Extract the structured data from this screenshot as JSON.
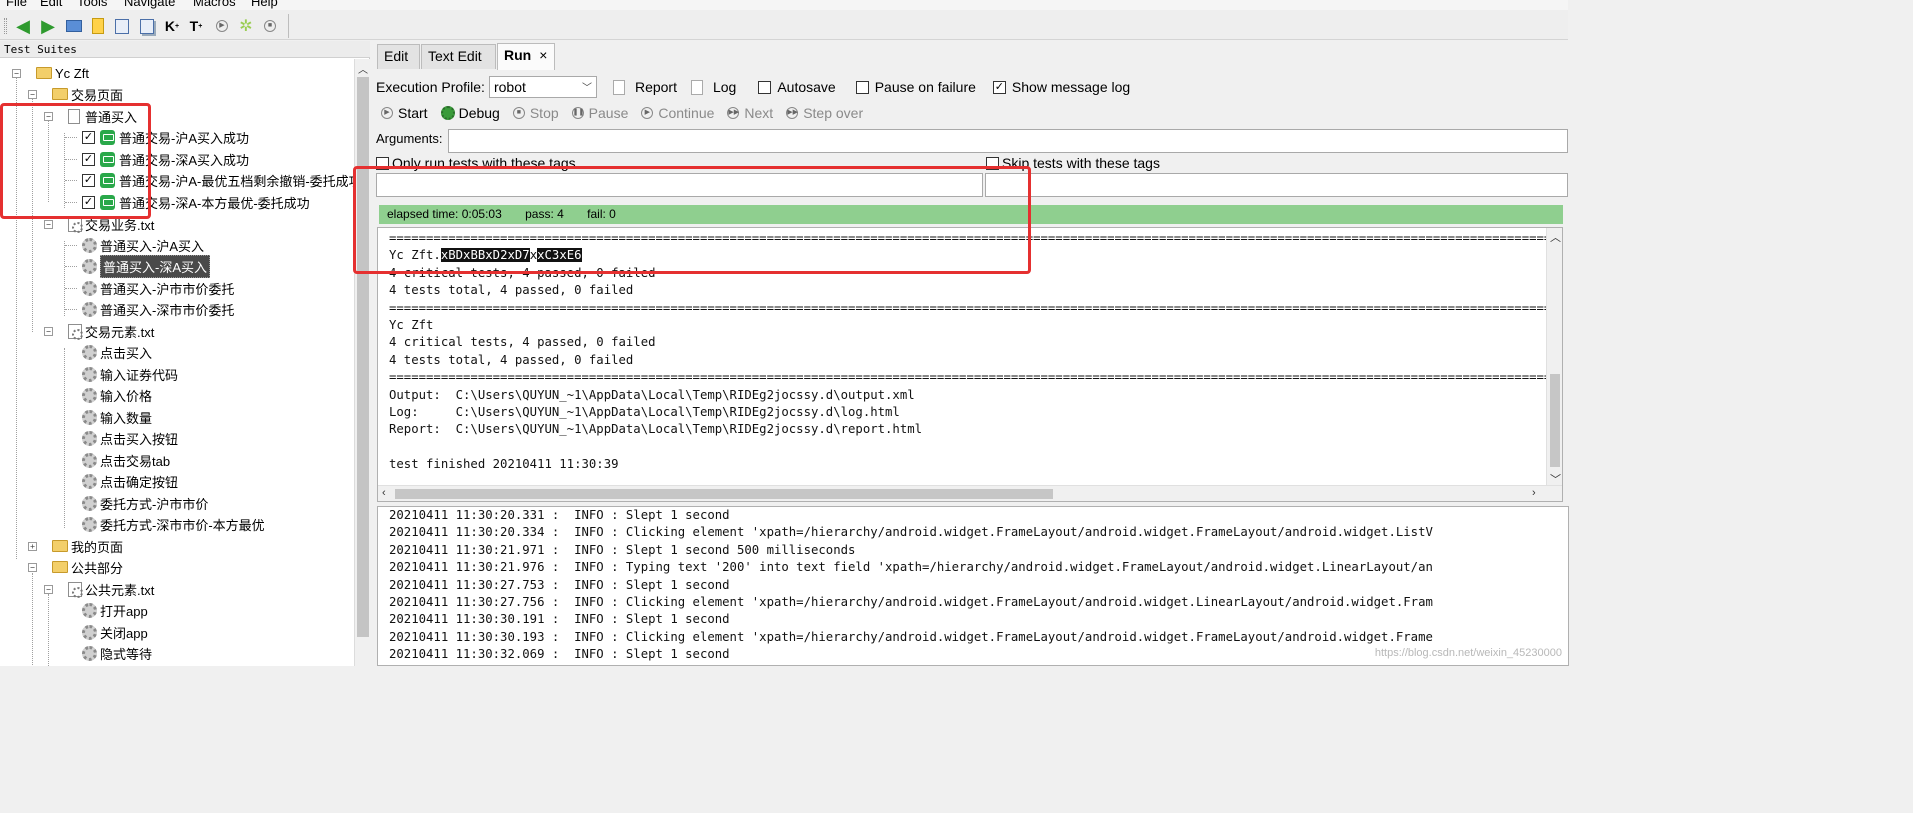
{
  "menu": [
    "File",
    "Edit",
    "Tools",
    "Navigate",
    "Macros",
    "Help"
  ],
  "toolbar_icons": [
    "back-arrow-icon",
    "forward-arrow-icon",
    "open-folder-icon",
    "new-file-icon",
    "save-icon",
    "save-all-icon",
    "keyword-k-icon",
    "text-t-icon",
    "play-icon",
    "settings-gear-icon",
    "stop-icon"
  ],
  "tree": {
    "title": "Test Suites",
    "root": "Yc Zft",
    "folder_trade": "交易页面",
    "suite_buy": "普通买入",
    "cases": [
      "普通交易-沪A买入成功",
      "普通交易-深A买入成功",
      "普通交易-沪A-最优五档剩余撤销-委托成功",
      "普通交易-深A-本方最优-委托成功"
    ],
    "resource_biz": "交易业务.txt",
    "biz_keywords": [
      "普通买入-沪A买入",
      "普通买入-深A买入",
      "普通买入-沪市市价委托",
      "普通买入-深市市价委托"
    ],
    "resource_elem": "交易元素.txt",
    "elem_keywords": [
      "点击买入",
      "输入证券代码",
      "输入价格",
      "输入数量",
      "点击买入按钮",
      "点击交易tab",
      "点击确定按钮",
      "委托方式-沪市市价",
      "委托方式-深市市价-本方最优"
    ],
    "folder_mine": "我的页面",
    "folder_common": "公共部分",
    "resource_common": "公共元素.txt",
    "common_keywords": [
      "打开app",
      "关闭app",
      "隐式等待"
    ]
  },
  "tabs": {
    "edit": "Edit",
    "text_edit": "Text Edit",
    "run": "Run",
    "close": "×"
  },
  "run": {
    "profile_label": "Execution Profile:",
    "profile_value": "robot",
    "report": "Report",
    "log": "Log",
    "autosave": "Autosave",
    "pause_on_failure": "Pause on failure",
    "show_message_log": "Show message log",
    "start": "Start",
    "debug": "Debug",
    "stop": "Stop",
    "pause": "Pause",
    "continue": "Continue",
    "next": "Next",
    "step_over": "Step over",
    "arguments_label": "Arguments:",
    "only_run_tags": "Only run tests with these tags",
    "skip_tags": "Skip tests with these tags",
    "status_color": "#8fcf8f"
  },
  "status": {
    "elapsed": "elapsed time: 0:05:03",
    "pass": "pass: 4",
    "fail": "fail: 0"
  },
  "console": {
    "sep": "==============================================================================================================================================================================================",
    "suite_prefix": "Yc Zft.",
    "suite_hex": [
      "xBD",
      "xBB",
      "xD2",
      "xD7",
      "x",
      "xC3",
      "xE6"
    ],
    "crit1": "4 critical tests, 4 passed, 0 failed",
    "total1": "4 tests total, 4 passed, 0 failed",
    "suite2": "Yc Zft",
    "crit2": "4 critical tests, 4 passed, 0 failed",
    "total2": "4 tests total, 4 passed, 0 failed",
    "output": "Output:  C:\\Users\\QUYUN_~1\\AppData\\Local\\Temp\\RIDEg2jocssy.d\\output.xml",
    "log": "Log:     C:\\Users\\QUYUN_~1\\AppData\\Local\\Temp\\RIDEg2jocssy.d\\log.html",
    "report": "Report:  C:\\Users\\QUYUN_~1\\AppData\\Local\\Temp\\RIDEg2jocssy.d\\report.html",
    "finished": "test finished 20210411 11:30:39"
  },
  "message_log": [
    "20210411 11:30:20.331 :  INFO : Slept 1 second",
    "20210411 11:30:20.334 :  INFO : Clicking element 'xpath=/hierarchy/android.widget.FrameLayout/android.widget.FrameLayout/android.widget.ListV",
    "20210411 11:30:21.971 :  INFO : Slept 1 second 500 milliseconds",
    "20210411 11:30:21.976 :  INFO : Typing text '200' into text field 'xpath=/hierarchy/android.widget.FrameLayout/android.widget.LinearLayout/an",
    "20210411 11:30:27.753 :  INFO : Slept 1 second",
    "20210411 11:30:27.756 :  INFO : Clicking element 'xpath=/hierarchy/android.widget.FrameLayout/android.widget.LinearLayout/android.widget.Fram",
    "20210411 11:30:30.191 :  INFO : Slept 1 second",
    "20210411 11:30:30.193 :  INFO : Clicking element 'xpath=/hierarchy/android.widget.FrameLayout/android.widget.FrameLayout/android.widget.Frame",
    "20210411 11:30:32.069 :  INFO : Slept 1 second"
  ],
  "watermark": "https://blog.csdn.net/weixin_45230000",
  "accent_red": "#e53030"
}
